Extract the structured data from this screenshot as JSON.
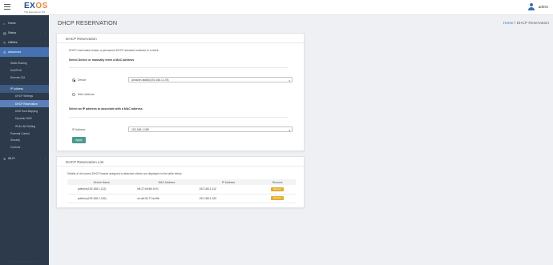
{
  "header": {
    "logo_ex": "EX",
    "logo_os": "OS",
    "logo_tagline": "The Experience OS",
    "user_name": "admin"
  },
  "sidebar": {
    "items": [
      {
        "icon": "home-icon",
        "glyph": "⌂",
        "label": "Home"
      },
      {
        "icon": "status-icon",
        "glyph": "▤",
        "label": "Status"
      },
      {
        "icon": "utilities-icon",
        "glyph": "✎",
        "label": "Utilities"
      },
      {
        "icon": "advanced-icon",
        "glyph": "⚙",
        "label": "Advanced"
      }
    ],
    "advanced_subs": [
      "Static Routing",
      "DoS/IPv6",
      "Remote GUI"
    ],
    "ip_address_label": "IP Address",
    "ip_subs": [
      "DHCP Settings",
      "DHCP Reservation",
      "DNS Host Mapping",
      "Dynamic DNS",
      "IPv6 LAN Setting"
    ],
    "after_ip": [
      "Parental Control",
      "Security",
      "Controls"
    ],
    "wifi_label": "Wi-Fi",
    "footer": "© Calix | All Rights Reserved"
  },
  "page": {
    "title": "DHCP RESERVATION",
    "breadcrumb_home": "Home",
    "breadcrumb_sep": "/",
    "breadcrumb_current": "DHCP Reservation"
  },
  "reservation_card": {
    "title": "DHCP Reservation",
    "description": "DHCP reservation leases a permanent DHCP allocated address to a client.",
    "select_heading": "Select Device or manually enter a MAC address",
    "device_label": "Device",
    "device_value": "Amazon-fast8c(192.168.1.178)",
    "mac_label": "MAC Address",
    "ip_heading": "Select an IP address to associate with a MAC address",
    "ip_label": "IP Address",
    "ip_value": "192.168.1.188",
    "apply_label": "Apply"
  },
  "list_card": {
    "title": "DHCP Reservation List",
    "description": "Details of all current DHCP leases assigned to attached clients are displayed in the table below.",
    "columns": [
      "Device Name",
      "MAC Address",
      "IP Address",
      "Remove"
    ],
    "rows": [
      {
        "device": "pdevice(192.168.1.112)",
        "mac": "b8:27:eb:65:1f:01",
        "ip": "192.168.1.112",
        "remove": "Remove"
      },
      {
        "device": "pdevice(192.168.1.152)",
        "mac": "dc:a6:32:77:a4:8b",
        "ip": "192.168.1.152",
        "remove": "Remove"
      }
    ]
  },
  "colors": {
    "sidebar_bg": "#2c3a4b",
    "active_blue": "#4672b2",
    "apply_green": "#4a9a8a",
    "remove_yellow": "#e3ad2d"
  }
}
